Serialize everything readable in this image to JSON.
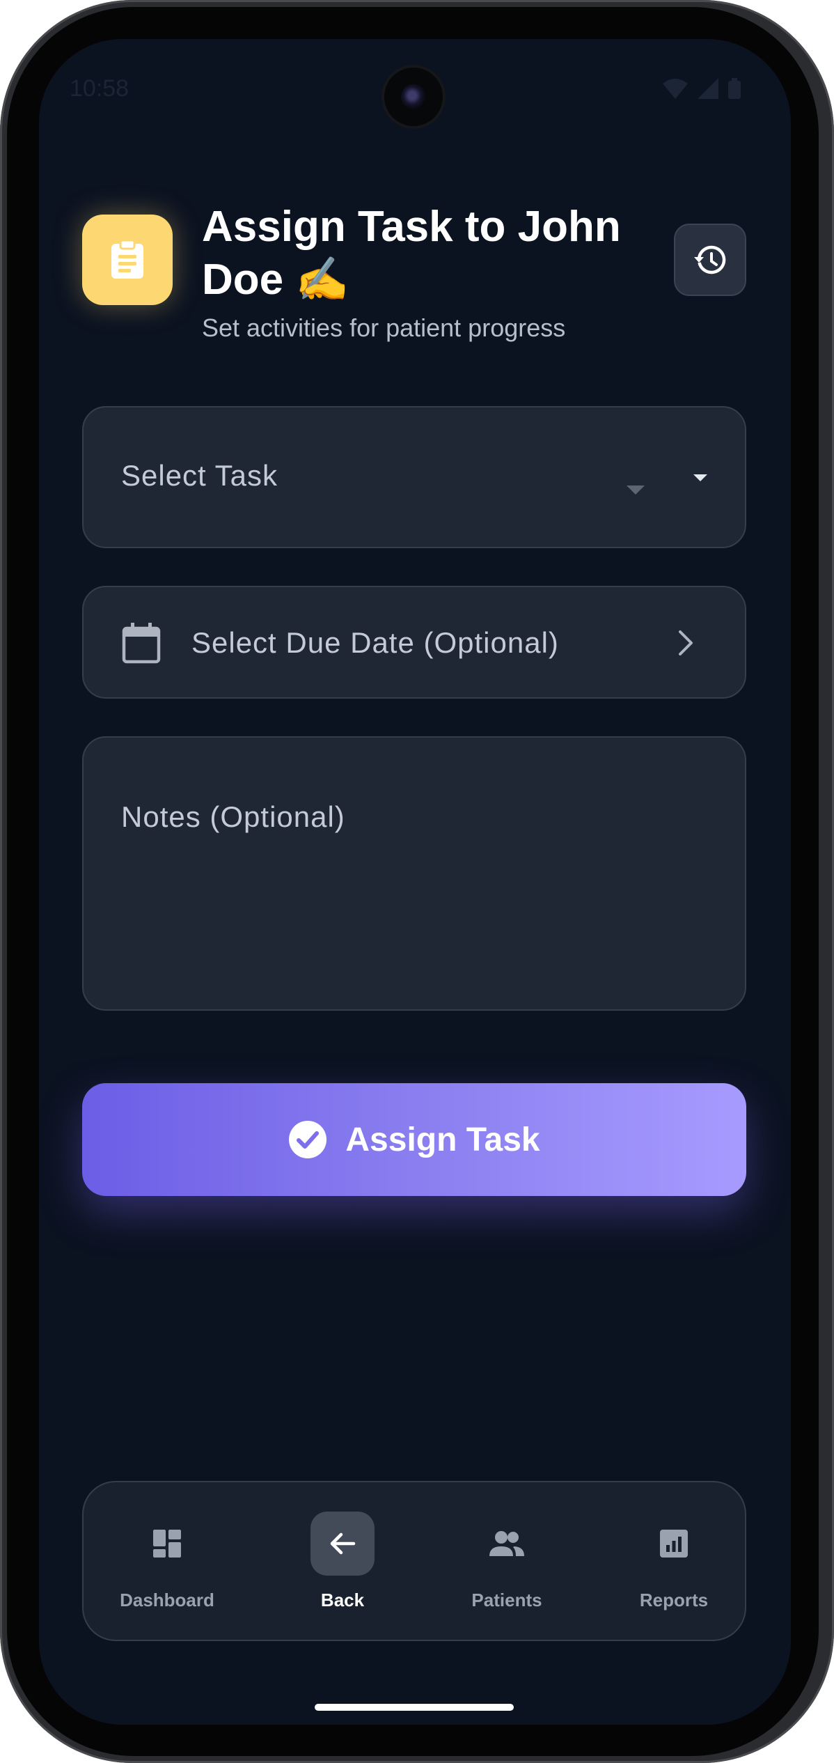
{
  "status_bar": {
    "time": "10:58",
    "icons": [
      "wifi-icon",
      "signal-icon",
      "battery-icon"
    ]
  },
  "header": {
    "title": "Assign Task to John Doe ✍️",
    "subtitle": "Set activities for patient progress",
    "icon": "clipboard-icon",
    "history_icon": "history-icon",
    "accent_color": "#fdd872"
  },
  "form": {
    "task_select": {
      "placeholder": "Select Task"
    },
    "due_date": {
      "placeholder": "Select Due Date (Optional)"
    },
    "notes": {
      "placeholder": "Notes (Optional)"
    }
  },
  "submit": {
    "label": "Assign Task",
    "icon": "check-circle-icon",
    "gradient": [
      "#6c5ee6",
      "#a79bff"
    ]
  },
  "bottom_nav": {
    "items": [
      {
        "label": "Dashboard",
        "icon": "dashboard-icon",
        "active": false
      },
      {
        "label": "Back",
        "icon": "arrow-left-icon",
        "active": true
      },
      {
        "label": "Patients",
        "icon": "people-icon",
        "active": false
      },
      {
        "label": "Reports",
        "icon": "bar-chart-icon",
        "active": false
      }
    ]
  }
}
